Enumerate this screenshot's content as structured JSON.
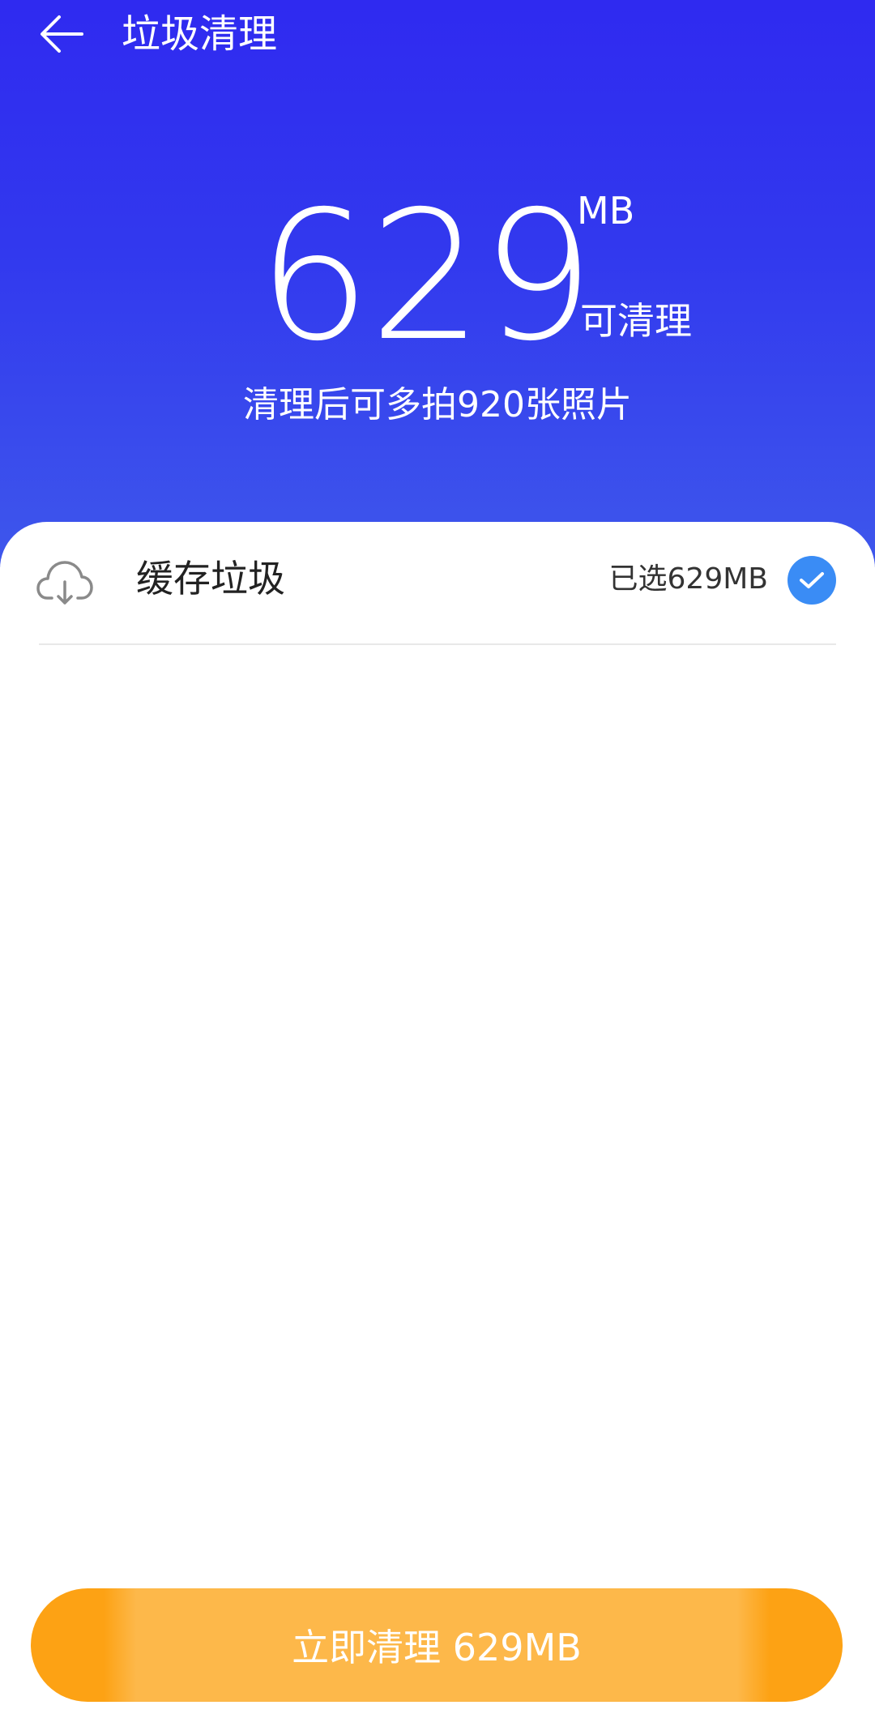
{
  "header": {
    "title": "垃圾清理",
    "back_icon": "arrow-left-icon"
  },
  "summary": {
    "size_value": "629",
    "size_unit": "MB",
    "cleanable_label": "可清理",
    "subtitle": "清理后可多拍920张照片"
  },
  "items": [
    {
      "icon": "cloud-download-icon",
      "label": "缓存垃圾",
      "status": "已选629MB",
      "checked": true
    }
  ],
  "action": {
    "clean_button_label": "立即清理 629MB"
  },
  "colors": {
    "hero_top": "#2f2af0",
    "hero_bottom": "#3e57ec",
    "check_blue": "#3a8cf5",
    "button_orange": "#fda214",
    "button_orange_light": "#fdb84a"
  }
}
